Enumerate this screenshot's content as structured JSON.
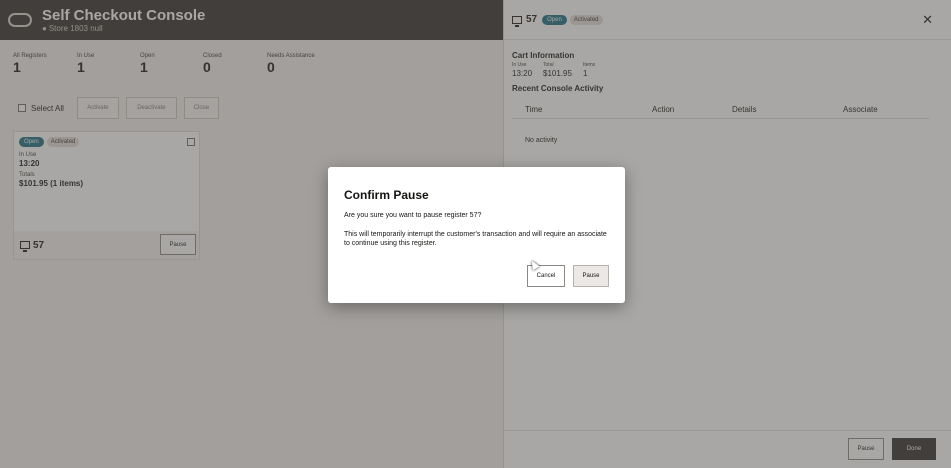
{
  "app": {
    "title": "Self Checkout Console",
    "store_icon": "location-pin-icon",
    "store": "Store 1803 null"
  },
  "stats": [
    {
      "label": "All Registers",
      "value": "1"
    },
    {
      "label": "In Use",
      "value": "1"
    },
    {
      "label": "Open",
      "value": "1"
    },
    {
      "label": "Closed",
      "value": "0"
    },
    {
      "label": "Needs Assistance",
      "value": "0"
    }
  ],
  "toolbar": {
    "select_all": "Select All",
    "activate": "Activate",
    "deactivate": "Deactivate",
    "close": "Close"
  },
  "register_card": {
    "status_open": "Open",
    "status_activated": "Activated",
    "in_use_label": "In Use",
    "in_use_value": "13:20",
    "totals_label": "Totals",
    "totals_value": "$101.95 (1 items)",
    "register_number": "57",
    "pause_label": "Pause"
  },
  "drawer": {
    "register_number": "57",
    "status_open": "Open",
    "status_activated": "Activated",
    "close_icon": "✕",
    "cart_title": "Cart Information",
    "cart": [
      {
        "label": "In Use",
        "value": "13:20"
      },
      {
        "label": "Total",
        "value": "$101.95"
      },
      {
        "label": "Items",
        "value": "1"
      }
    ],
    "activity_title": "Recent Console Activity",
    "columns": [
      "Time",
      "Action",
      "Details",
      "Associate"
    ],
    "empty_text": "No activity",
    "footer_pause": "Pause",
    "footer_done": "Done"
  },
  "dialog": {
    "title": "Confirm Pause",
    "question": "Are you sure you want to pause register 57?",
    "body": "This will temporarily interrupt the customer's transaction and will require an associate to continue using this register.",
    "cancel": "Cancel",
    "confirm": "Pause"
  },
  "colors": {
    "header_bg": "#312d2a",
    "open_pill": "#196c80",
    "done_button": "#312d2a"
  }
}
